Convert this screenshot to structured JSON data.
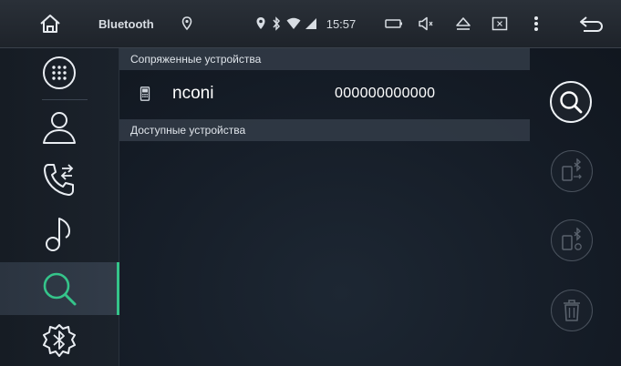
{
  "status_bar": {
    "app_title": "Bluetooth",
    "time": "15:57",
    "icons": [
      "home-icon",
      "location-pin-icon",
      "location-icon",
      "bluetooth-icon",
      "wifi-icon",
      "signal-icon",
      "battery-icon",
      "volume-icon",
      "eject-icon",
      "screenshot-icon",
      "menu-icon",
      "back-icon"
    ]
  },
  "sidebar": {
    "items": [
      {
        "name": "dialpad",
        "icon": "dialpad-icon",
        "active": false
      },
      {
        "name": "contacts",
        "icon": "contacts-icon",
        "active": false
      },
      {
        "name": "call-log",
        "icon": "call-log-icon",
        "active": false
      },
      {
        "name": "music",
        "icon": "music-icon",
        "active": false
      },
      {
        "name": "search-devices",
        "icon": "search-icon",
        "active": true
      },
      {
        "name": "bluetooth-settings",
        "icon": "bluetooth-settings-icon",
        "active": false
      }
    ]
  },
  "main": {
    "paired_header": "Сопряженные устройства",
    "paired_devices": [
      {
        "name": "nconi",
        "address": "000000000000"
      }
    ],
    "available_header": "Доступные устройства"
  },
  "actions": [
    {
      "name": "search",
      "icon": "search-icon",
      "enabled": true
    },
    {
      "name": "connect",
      "icon": "phone-bluetooth-connect-icon",
      "enabled": false
    },
    {
      "name": "disconnect",
      "icon": "phone-bluetooth-disconnect-icon",
      "enabled": false
    },
    {
      "name": "delete",
      "icon": "trash-icon",
      "enabled": false
    }
  ],
  "colors": {
    "accent": "#35c48a",
    "background": "#141b25",
    "section_header": "#37404c",
    "text": "#ffffff"
  }
}
